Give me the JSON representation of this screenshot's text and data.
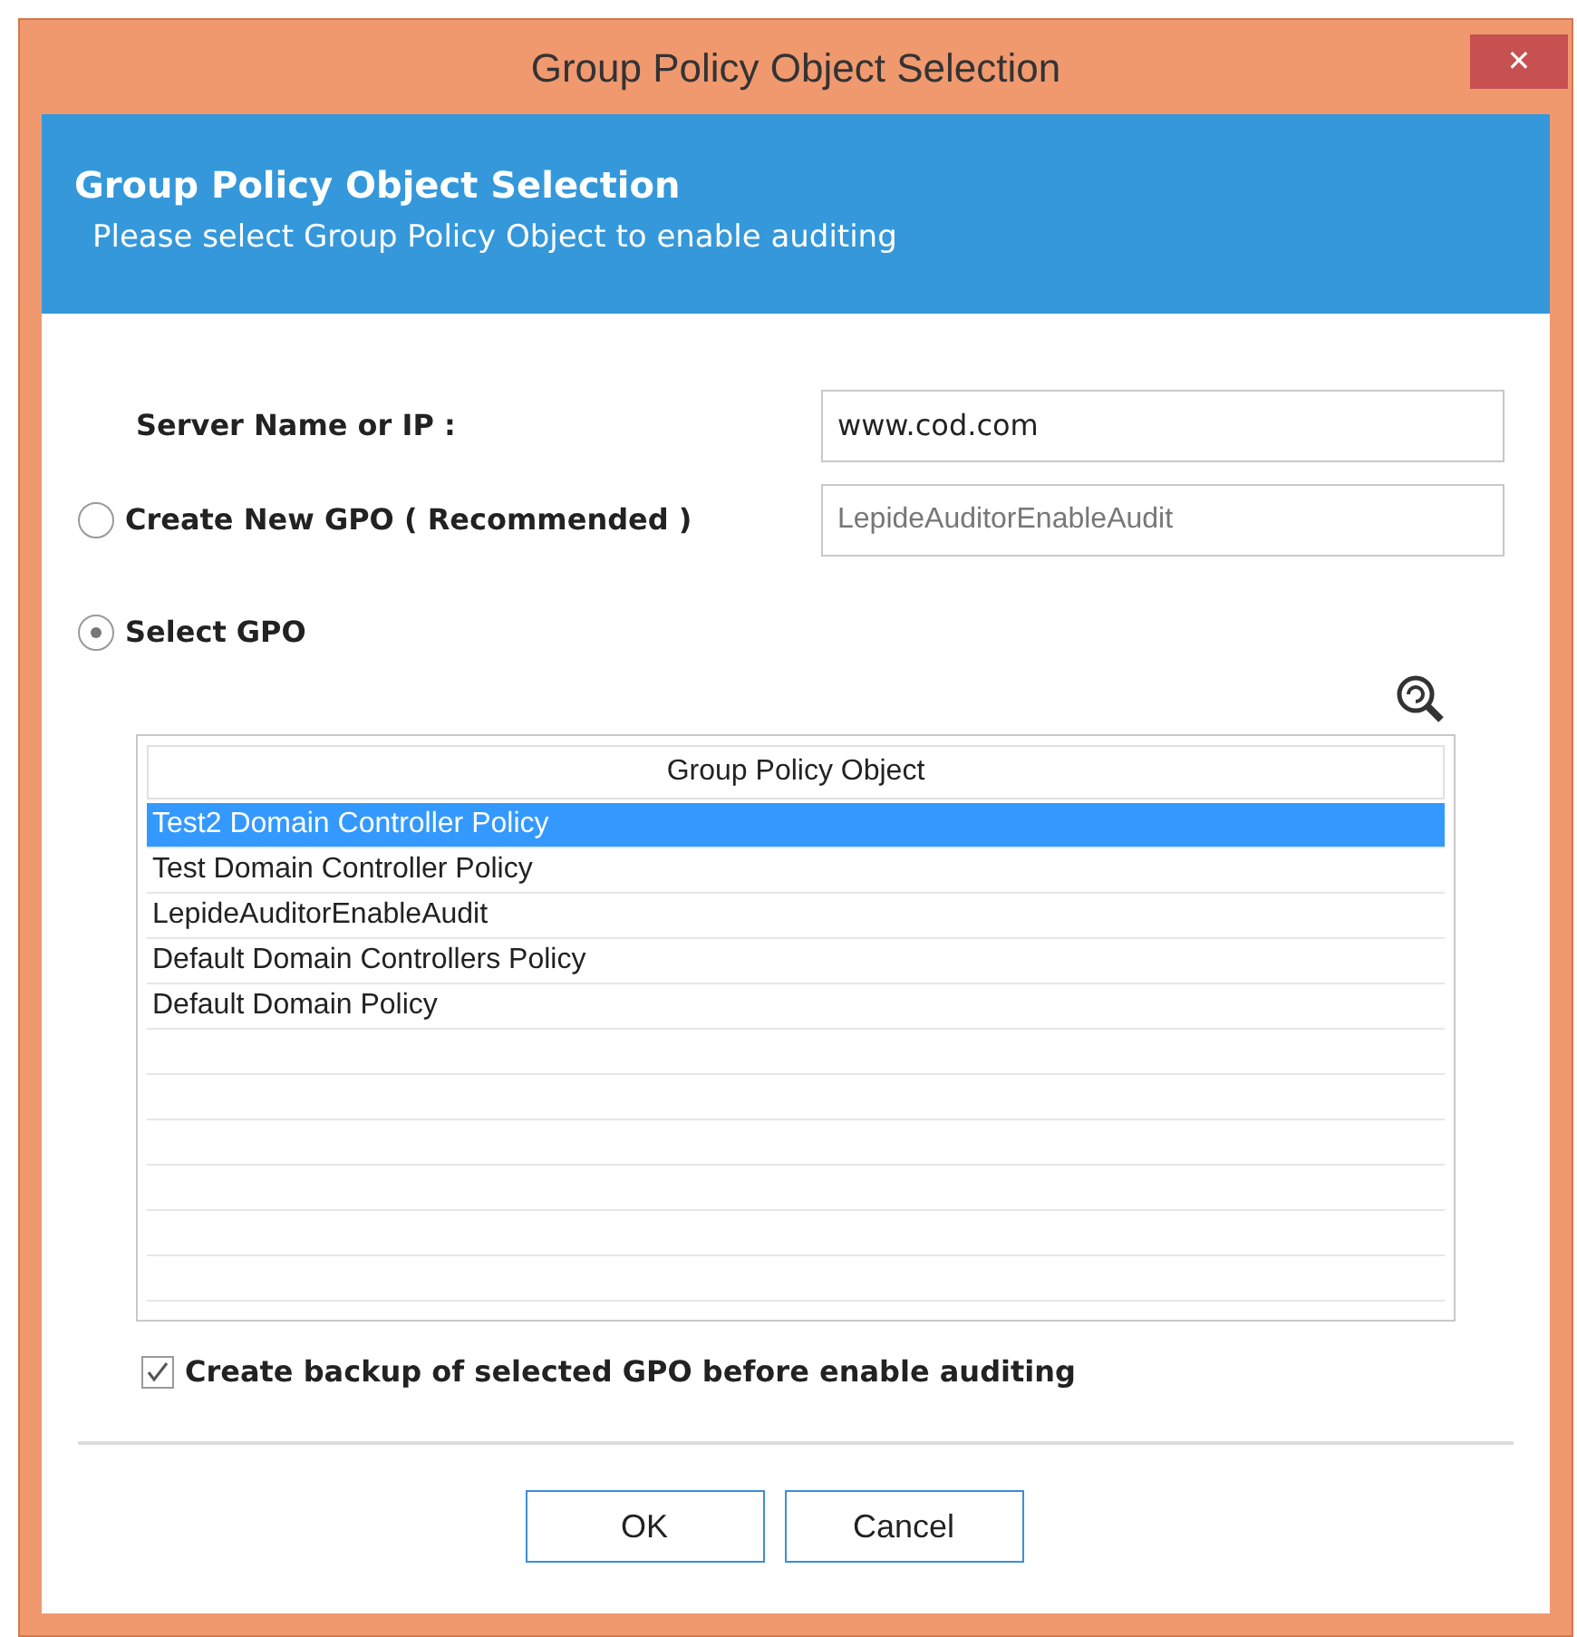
{
  "window": {
    "title": "Group Policy Object Selection",
    "close": "✕"
  },
  "header": {
    "title": "Group Policy Object Selection",
    "subtitle": "Please select Group Policy Object to enable auditing"
  },
  "server": {
    "label": "Server Name or IP :",
    "value": "www.cod.com"
  },
  "options": [
    {
      "label": "Create New GPO ( Recommended )",
      "selected": false,
      "field": {
        "value": "LepideAuditorEnableAudit",
        "disabled": true
      }
    },
    {
      "label": "Select GPO",
      "selected": true
    }
  ],
  "table": {
    "columns": [
      "Group Policy Object"
    ],
    "rows": [
      {
        "name": "Test2 Domain Controller Policy",
        "selected": true
      },
      {
        "name": "Test Domain Controller Policy",
        "selected": false
      },
      {
        "name": "LepideAuditorEnableAudit",
        "selected": false
      },
      {
        "name": "Default Domain Controllers Policy",
        "selected": false
      },
      {
        "name": "Default Domain Policy",
        "selected": false
      }
    ]
  },
  "backup": {
    "label": "Create backup of selected GPO before enable auditing",
    "checked": true
  },
  "buttons": [
    "OK",
    "Cancel"
  ]
}
